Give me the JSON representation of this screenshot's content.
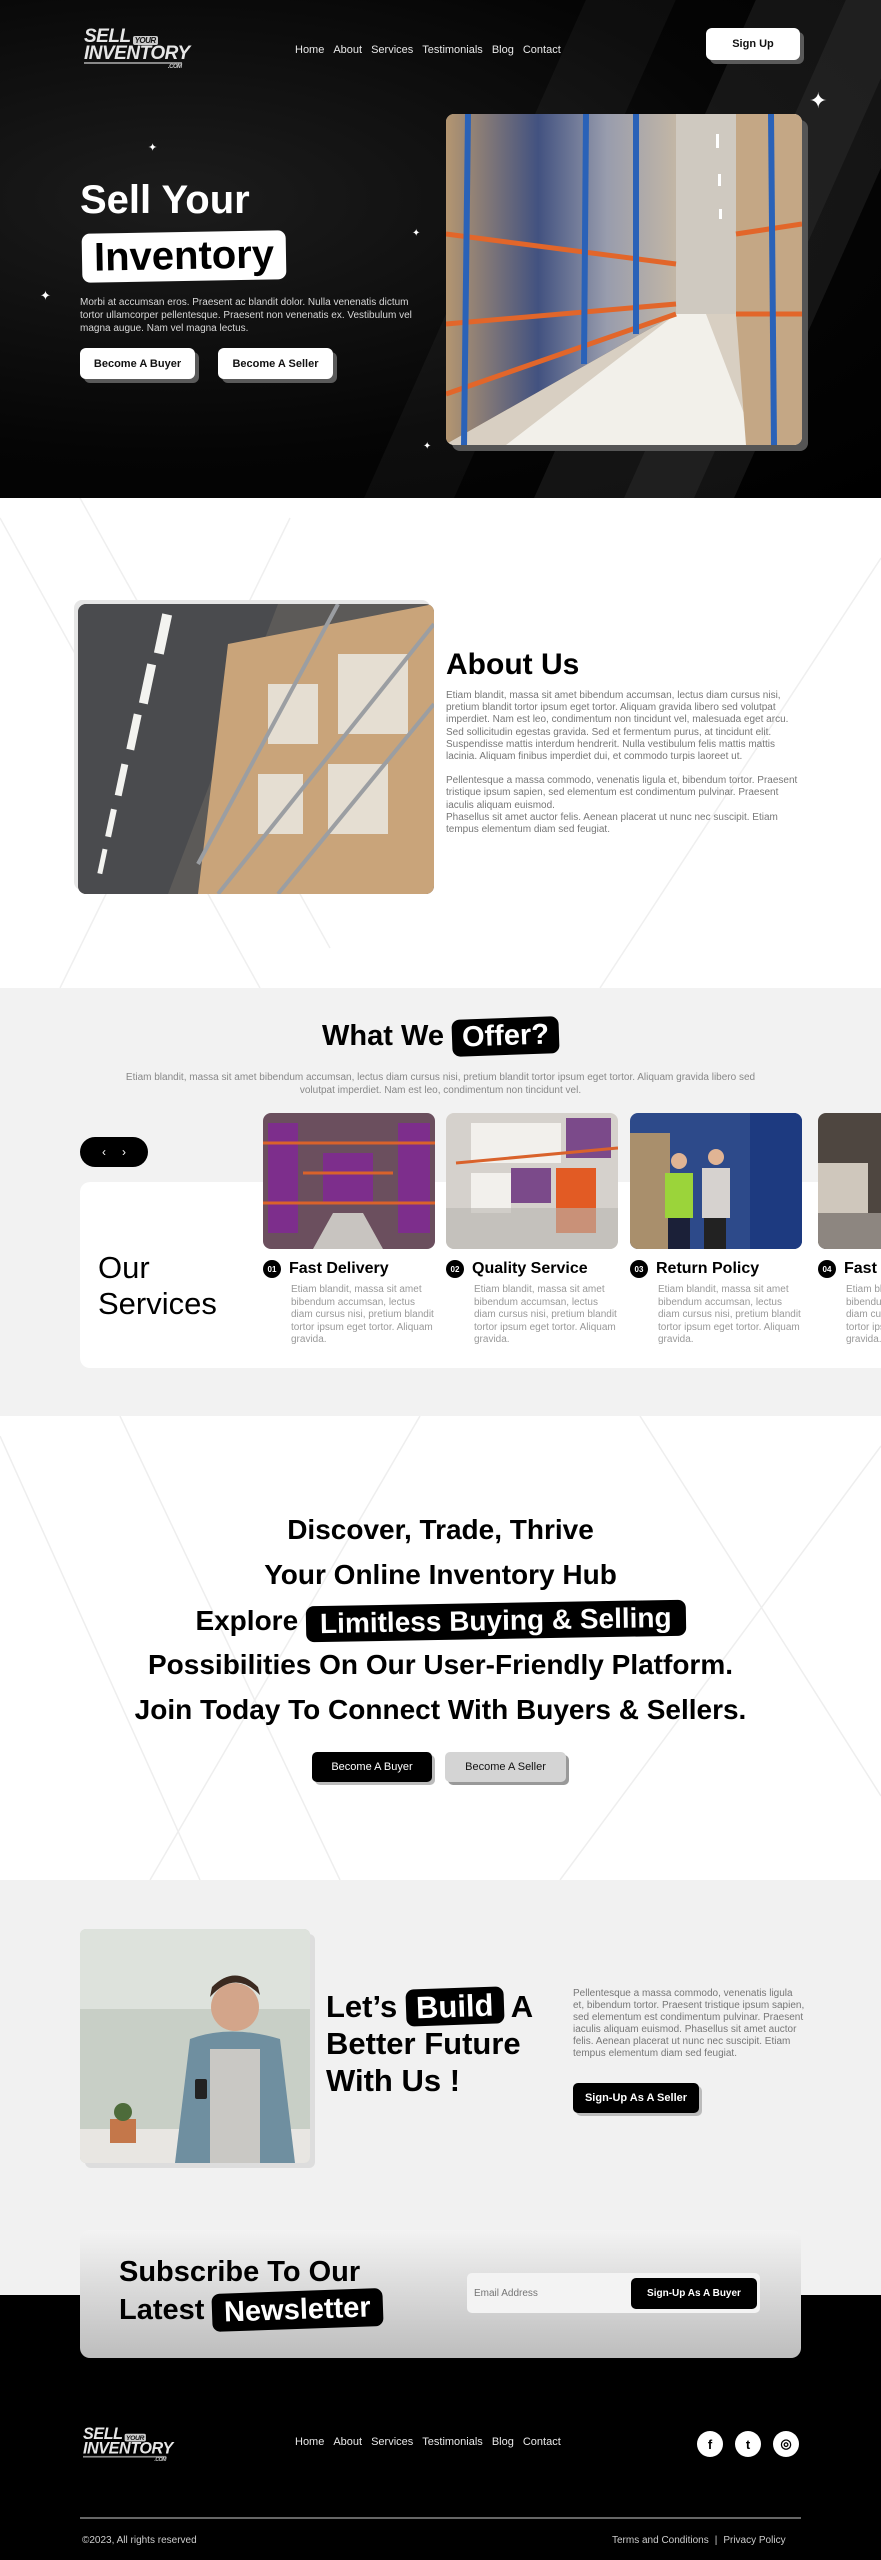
{
  "brand": {
    "line1": "SELL",
    "your": "YOUR",
    "line2": "INVENTORY",
    "com": ".COM"
  },
  "nav": [
    "Home",
    "About",
    "Services",
    "Testimonials",
    "Blog",
    "Contact"
  ],
  "header": {
    "signup_label": "Sign Up"
  },
  "hero": {
    "title_line1": "Sell Your",
    "title_line2": "Inventory",
    "paragraph": "Morbi at accumsan eros. Praesent ac blandit dolor. Nulla venenatis dictum tortor ullamcorper pellentesque. Praesent non venenatis ex. Vestibulum vel magna augue. Nam vel magna lectus.",
    "buyer_button": "Become A Buyer",
    "seller_button": "Become A Seller",
    "image_alt": "warehouse-aisle-photo"
  },
  "about": {
    "title": "About Us",
    "paragraph1": "Etiam blandit, massa sit amet bibendum accumsan, lectus diam cursus nisi, pretium blandit tortor ipsum eget tortor. Aliquam gravida libero sed volutpat imperdiet. Nam est leo, condimentum non tincidunt vel, malesuada eget arcu. Sed sollicitudin egestas gravida. Sed et fermentum purus, at tincidunt elit. Suspendisse mattis interdum hendrerit. Nulla vestibulum felis mattis mattis lacinia. Aliquam finibus imperdiet dui, et commodo turpis laoreet ut.",
    "paragraph2": "Pellentesque a massa commodo, venenatis ligula et, bibendum tortor. Praesent tristique ipsum sapien, sed elementum est condimentum pulvinar. Praesent iaculis aliquam euismod.",
    "paragraph3": "Phasellus sit amet auctor felis. Aenean placerat ut nunc nec suscipit. Etiam tempus elementum diam sed feugiat."
  },
  "offer": {
    "title_plain": "What We",
    "title_highlight": "Offer?",
    "paragraph": "Etiam blandit, massa sit amet bibendum accumsan, lectus diam cursus nisi, pretium blandit tortor ipsum eget tortor. Aliquam gravida libero sed volutpat imperdiet. Nam est leo, condimentum non tincidunt vel.",
    "prev_icon": "‹",
    "next_icon": "›",
    "services_heading_line1": "Our",
    "services_heading_line2": "Services",
    "services": [
      {
        "num": "01",
        "title": "Fast Delivery",
        "text": "Etiam blandit, massa sit amet bibendum accumsan, lectus diam cursus nisi, pretium blandit tortor ipsum eget tortor. Aliquam gravida."
      },
      {
        "num": "02",
        "title": "Quality Service",
        "text": "Etiam blandit, massa sit amet bibendum accumsan, lectus diam cursus nisi, pretium blandit tortor ipsum eget tortor. Aliquam gravida."
      },
      {
        "num": "03",
        "title": "Return Policy",
        "text": "Etiam blandit, massa sit amet bibendum accumsan, lectus diam cursus nisi, pretium blandit tortor ipsum eget tortor. Aliquam gravida."
      },
      {
        "num": "04",
        "title": "Fast Delivery",
        "text": "Etiam blandit, massa sit amet bibendum accumsan, lectus diam cursus nisi, pretium blandit tortor ipsum eget tortor. Aliquam gravida."
      }
    ]
  },
  "discover": {
    "line1": "Discover, Trade, Thrive",
    "line2": "Your Online Inventory Hub",
    "line3_plain": "Explore",
    "line3_highlight": "Limitless Buying & Selling",
    "line4": "Possibilities On Our User-Friendly Platform.",
    "line5": "Join Today To Connect With Buyers & Sellers.",
    "buyer_button": "Become A Buyer",
    "seller_button": "Become A Seller"
  },
  "build": {
    "title_pre": "Let’s",
    "title_highlight": "Build",
    "title_post": "A",
    "title_line2": "Better Future",
    "title_line3": "With Us !",
    "paragraph": "Pellentesque a massa commodo, venenatis ligula et, bibendum tortor. Praesent tristique ipsum sapien, sed elementum est condimentum pulvinar. Praesent iaculis aliquam euismod. Phasellus sit amet auctor felis. Aenean placerat ut nunc nec suscipit. Etiam tempus elementum diam sed feugiat.",
    "button": "Sign-Up As A Seller"
  },
  "newsletter": {
    "title_line1": "Subscribe To Our",
    "title_line2_plain": "Latest",
    "title_line2_highlight": "Newsletter",
    "email_placeholder": "Email Address",
    "button": "Sign-Up As A Buyer"
  },
  "footer": {
    "social": [
      {
        "name": "facebook",
        "glyph": "f"
      },
      {
        "name": "twitter",
        "glyph": "t"
      },
      {
        "name": "instagram",
        "glyph": "◎"
      }
    ],
    "copyright": "©2023, All rights reserved",
    "terms": "Terms and Conditions",
    "separator": "|",
    "privacy": "Privacy Policy"
  }
}
